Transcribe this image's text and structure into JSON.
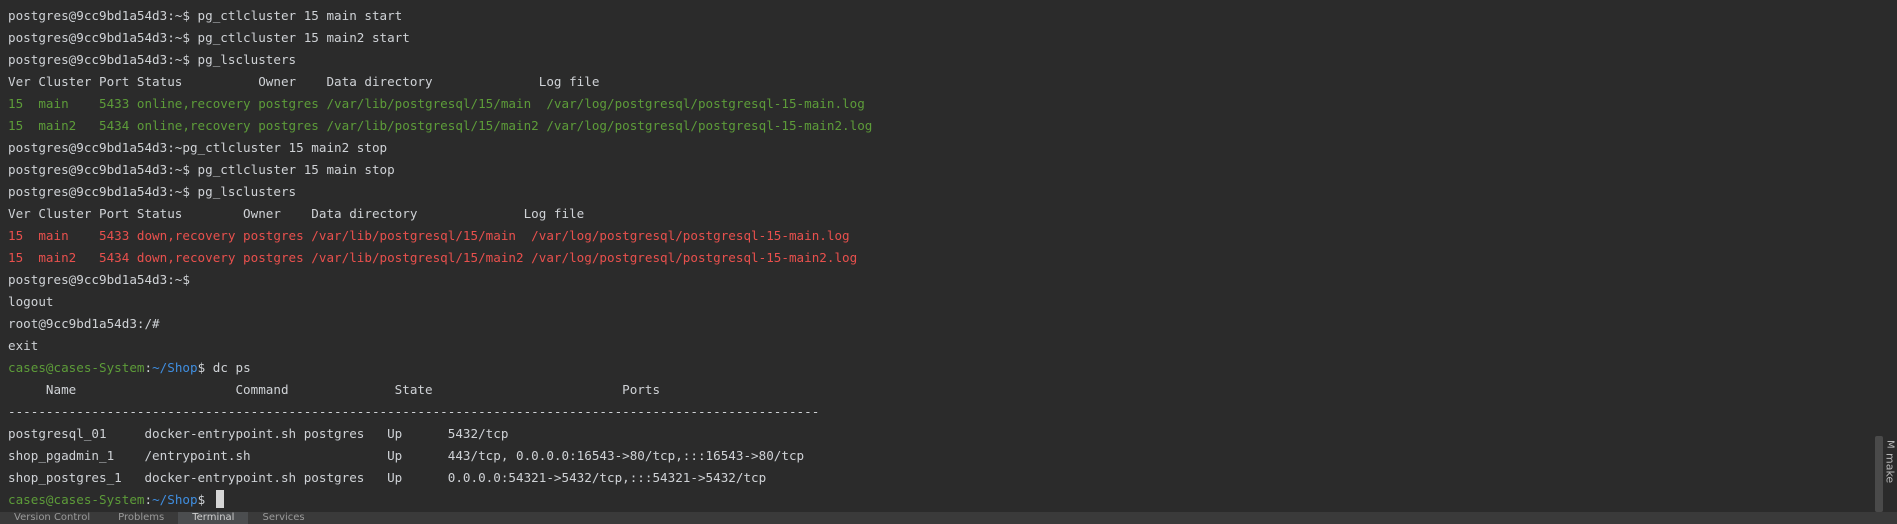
{
  "terminal": {
    "lines": [
      {
        "type": "plain",
        "text": "postgres@9cc9bd1a54d3:~$ pg_ctlcluster 15 main start"
      },
      {
        "type": "plain",
        "text": "postgres@9cc9bd1a54d3:~$ pg_ctlcluster 15 main2 start"
      },
      {
        "type": "plain",
        "text": "postgres@9cc9bd1a54d3:~$ pg_lsclusters"
      },
      {
        "type": "plain",
        "text": "Ver Cluster Port Status          Owner    Data directory              Log file"
      },
      {
        "type": "green",
        "text": "15  main    5433 online,recovery postgres /var/lib/postgresql/15/main  /var/log/postgresql/postgresql-15-main.log"
      },
      {
        "type": "green",
        "text": "15  main2   5434 online,recovery postgres /var/lib/postgresql/15/main2 /var/log/postgresql/postgresql-15-main2.log"
      },
      {
        "type": "plain",
        "text": "postgres@9cc9bd1a54d3:~pg_ctlcluster 15 main2 stop"
      },
      {
        "type": "plain",
        "text": "postgres@9cc9bd1a54d3:~$ pg_ctlcluster 15 main stop"
      },
      {
        "type": "plain",
        "text": "postgres@9cc9bd1a54d3:~$ pg_lsclusters"
      },
      {
        "type": "plain",
        "text": "Ver Cluster Port Status        Owner    Data directory              Log file"
      },
      {
        "type": "red",
        "text": "15  main    5433 down,recovery postgres /var/lib/postgresql/15/main  /var/log/postgresql/postgresql-15-main.log"
      },
      {
        "type": "red",
        "text": "15  main2   5434 down,recovery postgres /var/lib/postgresql/15/main2 /var/log/postgresql/postgresql-15-main2.log"
      },
      {
        "type": "plain",
        "text": "postgres@9cc9bd1a54d3:~$"
      },
      {
        "type": "plain",
        "text": "logout"
      },
      {
        "type": "plain",
        "text": "root@9cc9bd1a54d3:/#"
      },
      {
        "type": "plain",
        "text": "exit"
      },
      {
        "type": "prompt",
        "user": "cases@cases-System",
        "sep": ":",
        "path": "~/Shop",
        "rest": "$ dc ps"
      },
      {
        "type": "plain",
        "text": "     Name                     Command              State                         Ports"
      },
      {
        "type": "plain",
        "text": "-----------------------------------------------------------------------------------------------------------"
      },
      {
        "type": "plain",
        "text": "postgresql_01     docker-entrypoint.sh postgres   Up      5432/tcp"
      },
      {
        "type": "plain",
        "text": "shop_pgadmin_1    /entrypoint.sh                  Up      443/tcp, 0.0.0.0:16543->80/tcp,:::16543->80/tcp"
      },
      {
        "type": "plain",
        "text": "shop_postgres_1   docker-entrypoint.sh postgres   Up      0.0.0.0:54321->5432/tcp,:::54321->5432/tcp"
      },
      {
        "type": "prompt",
        "user": "cases@cases-System",
        "sep": ":",
        "path": "~/Shop",
        "rest": "$ ",
        "cursor": true
      }
    ]
  },
  "side_tab": {
    "icon": "make-icon",
    "glyph": "M",
    "label": "make"
  },
  "bottom_tabs": [
    "Version Control",
    "Problems",
    "Terminal",
    "Services"
  ]
}
